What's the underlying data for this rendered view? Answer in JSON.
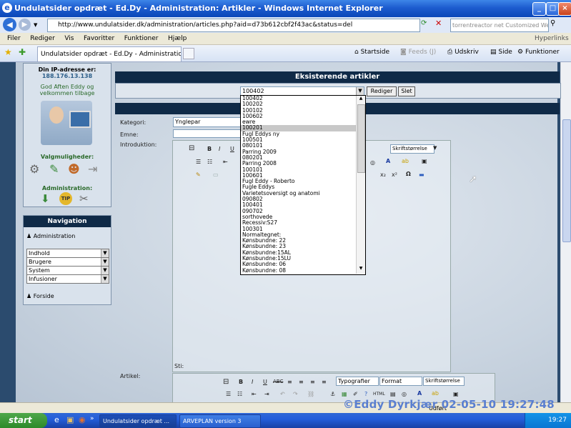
{
  "window": {
    "title": "Undulatsider opdræt - Ed.Dy - Administration: Artikler - Windows Internet Explorer",
    "controls": [
      "_",
      "□",
      "×"
    ]
  },
  "address": {
    "url": "http://www.undulatsider.dk/administration/articles.php?aid=d73b612cbf2f43ac&status=del",
    "search_placeholder": "torrentreactor net Customized Web Se..."
  },
  "menu": {
    "items": [
      "Filer",
      "Rediger",
      "Vis",
      "Favoritter",
      "Funktioner",
      "Hjælp"
    ],
    "right_link": "Hyperlinks"
  },
  "tabbar": {
    "tab_title": "Undulatsider opdræt - Ed.Dy - Administration: Artikler",
    "startside": "Startside",
    "feeds": "Feeds (J)",
    "udskriv": "Udskriv",
    "side": "Side",
    "funktioner": "Funktioner"
  },
  "left_panel": {
    "ip_label": "Din IP-adresse er:",
    "ip_value": "188.176.13.138",
    "greeting_line1": "God Aften Eddy og",
    "greeting_line2": "velkommen tilbage",
    "options_heading": "Valgmuligheder:",
    "admin_heading": "Administration:",
    "nav_heading": "Navigation",
    "nav_admin_link": "Administration",
    "nav_selects": [
      "Indhold",
      "Brugere",
      "System",
      "Infusioner"
    ],
    "nav_forside": "Forside"
  },
  "content": {
    "existing_heading": "Eksisterende artikler",
    "selected_article": "100402",
    "edit_button": "Rediger",
    "delete_button": "Slet",
    "kategori_label": "Kategori:",
    "kategori_value": "Ynglepar",
    "emne_label": "Emne:",
    "intro_label": "Introduktion:",
    "artikel_label": "Artikel:",
    "sti_label": "Sti:",
    "font_size_label": "Skriftstørrelse",
    "typografier_label": "Typografier",
    "format_label": "Format",
    "dropdown_options": [
      "100402",
      "100202",
      "100102",
      "100602",
      "ewre",
      "100201",
      "Fugl Eddys ny",
      "100501",
      "080101",
      "Parring 2009",
      "080201",
      "Parring 2008",
      "100101",
      "100601",
      "Fugl Eddy - Roberto",
      "Fugle Eddys",
      "Varietetsoversigt og anatomi",
      "090802",
      "100401",
      "090702",
      "sorthovede",
      "Recessiv:S27",
      "100301",
      "Normaltegnet:",
      "Kønsbundne: 22",
      "Kønsbundne: 23",
      "Kønsbundne:15AL",
      "Kønsbundne:15LU",
      "Kønsbundne: 06",
      "Kønsbundne: 08"
    ],
    "highlighted_option": "100201"
  },
  "statusbar": {
    "text": "Udført"
  },
  "taskbar": {
    "start": "start",
    "items": [
      "Undulatsider opdræt ...",
      "ARVEPLAN version 3"
    ],
    "clock": "19:27"
  },
  "watermark": "©Eddy Dyrkjær 02-05-10 19:27:48"
}
